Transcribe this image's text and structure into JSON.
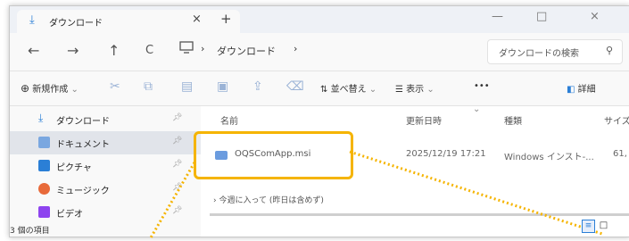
{
  "window": {
    "tab_title": "ダウンロード",
    "tab_close": "×",
    "new_tab": "+",
    "controls": {
      "minimize": "—",
      "maximize": "□",
      "close": "×"
    }
  },
  "nav": {
    "back": "←",
    "forward": "→",
    "up": "↑",
    "refresh": "C"
  },
  "address": {
    "separator": "›",
    "folder": "ダウンロード"
  },
  "search": {
    "placeholder": "ダウンロードの検索",
    "icon": "search-icon"
  },
  "toolbar": {
    "new_label": "新規作成",
    "sort_label": "並べ替え",
    "view_label": "表示",
    "more": "•••",
    "details_label": "詳細"
  },
  "sidebar": {
    "items": [
      {
        "label": "ダウンロード",
        "icon": "download-icon",
        "color": "#2b7fd6"
      },
      {
        "label": "ドキュメント",
        "icon": "document-icon",
        "color": "#7aa7e0"
      },
      {
        "label": "ピクチャ",
        "icon": "pictures-icon",
        "color": "#2b7fd6"
      },
      {
        "label": "ミュージック",
        "icon": "music-icon",
        "color": "#e86a3a"
      },
      {
        "label": "ビデオ",
        "icon": "video-icon",
        "color": "#8e44ef"
      }
    ],
    "status": "3 個の項目"
  },
  "columns": {
    "name": "名前",
    "date": "更新日時",
    "type": "種類",
    "size": "サイズ"
  },
  "file": {
    "name": "OQSComApp.msi",
    "date": "2025/12/19 17:21",
    "type": "Windows インスト-...",
    "size": "61,"
  },
  "group": {
    "label": "今週に入って (昨日は含めず)",
    "toggle": "›"
  },
  "colors": {
    "highlight": "#f5b400",
    "selected": "#e1e4ea"
  }
}
